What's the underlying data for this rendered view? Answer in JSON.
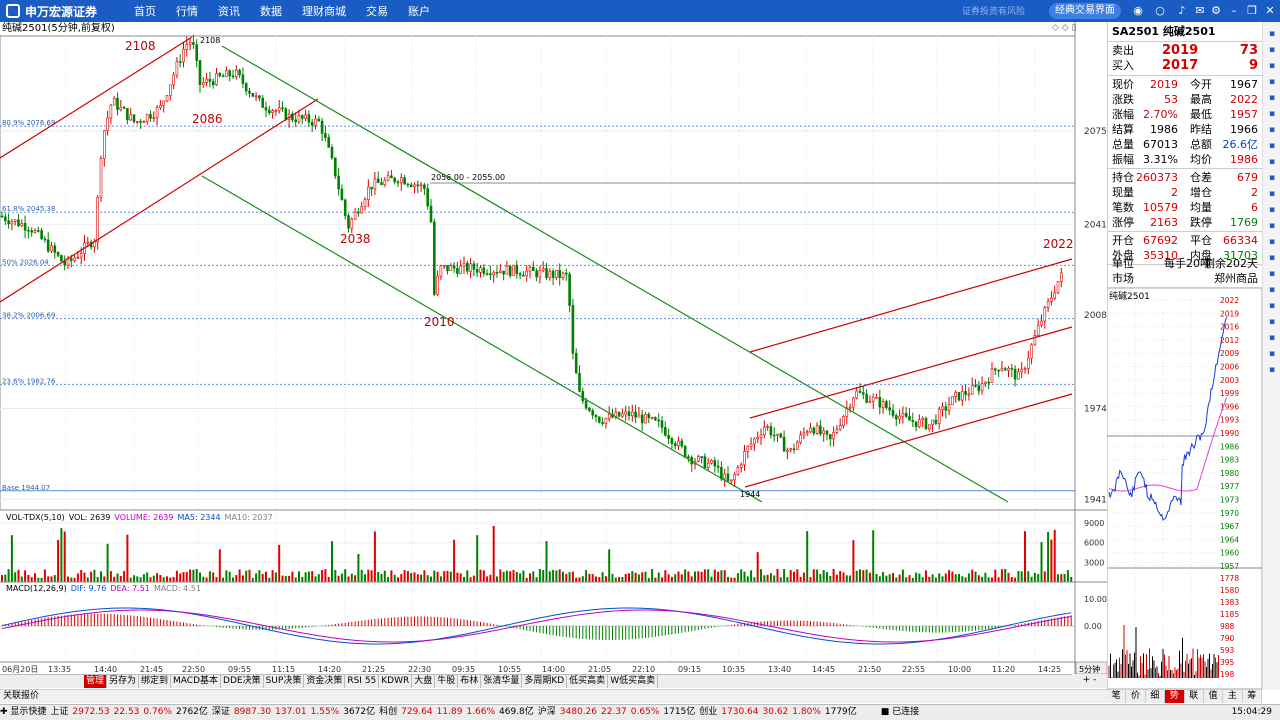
{
  "brand": {
    "name": "申万宏源证券",
    "sub": "SHENWAN HONGYUAN SECURITIES"
  },
  "nav": [
    "首页",
    "行情",
    "资讯",
    "数据",
    "理财商城",
    "交易",
    "账户"
  ],
  "top": {
    "slogan": "证券投资有风险",
    "classic_button": "经典交易界面",
    "icons": [
      "user-icon",
      "circle-icon",
      "bell-icon",
      "mail-icon",
      "gear-icon",
      "minimize-icon",
      "restore-icon",
      "close-icon"
    ]
  },
  "chart": {
    "title": "纯碱2501(5分钟,前复权)",
    "fib_levels": [
      {
        "label": "80.9% 2076.69",
        "value": 2076.69
      },
      {
        "label": "61.8% 2045.38",
        "value": 2045.38
      },
      {
        "label": "50% 2026.04",
        "value": 2026.04
      },
      {
        "label": "38.2% 2006.69",
        "value": 2006.69
      },
      {
        "label": "23.6% 1982.76",
        "value": 1982.76
      },
      {
        "label": "Base 1944.07",
        "value": 1944.07
      }
    ],
    "price_ticks": [
      "2075",
      "2041",
      "2008",
      "1974",
      "1941"
    ],
    "annotations": [
      {
        "text": "2108",
        "color": "red"
      },
      {
        "text": "2086",
        "color": "red"
      },
      {
        "text": "2038",
        "color": "red"
      },
      {
        "text": "2010",
        "color": "red"
      },
      {
        "text": "2022",
        "color": "red"
      }
    ],
    "marks": [
      "2108",
      "1944",
      "2056.00 - 2055.00"
    ],
    "volume_header": {
      "name": "VOL-TDX(5,10)",
      "vol": "VOL: 2639",
      "volume": "VOLUME: 2639",
      "ma5": "MA5: 2344",
      "ma10": "MA10: 2037"
    },
    "volume_ticks": [
      "9000",
      "6000",
      "3000"
    ],
    "macd_header": {
      "name": "MACD(12,26,9)",
      "dif": "DIF: 9.76",
      "dea": "DEA: 7.51",
      "macd": "MACD: 4.51"
    },
    "macd_ticks": [
      "10.00",
      "0.00"
    ],
    "time_ticks": [
      "06月20日",
      "13:35",
      "14:40",
      "21:45",
      "22:50",
      "09:55",
      "11:15",
      "14:20",
      "21:25",
      "22:30",
      "09:35",
      "10:55",
      "14:00",
      "21:05",
      "22:10",
      "09:15",
      "10:35",
      "13:40",
      "14:45",
      "21:50",
      "22:55",
      "10:00",
      "11:20",
      "14:25"
    ],
    "period": "5分钟"
  },
  "quote": {
    "title": "SA2501 纯碱2501",
    "sell": {
      "label": "卖出",
      "price": "2019",
      "qty": "73"
    },
    "buy": {
      "label": "买入",
      "price": "2017",
      "qty": "9"
    },
    "rows1": [
      [
        "现价",
        "2019",
        "今开",
        "1967"
      ],
      [
        "涨跌",
        "53",
        "最高",
        "2022"
      ],
      [
        "涨幅",
        "2.70%",
        "最低",
        "1957"
      ],
      [
        "结算",
        "1986",
        "昨结",
        "1966"
      ],
      [
        "总量",
        "67013",
        "总额",
        "26.6亿"
      ],
      [
        "振幅",
        "3.31%",
        "均价",
        "1986"
      ]
    ],
    "rows2": [
      [
        "持仓",
        "260373",
        "仓差",
        "679"
      ],
      [
        "现量",
        "2",
        "增仓",
        "2"
      ],
      [
        "笔数",
        "10579",
        "均量",
        "6"
      ],
      [
        "涨停",
        "2163",
        "跌停",
        "1769"
      ]
    ],
    "rows3": [
      [
        "开仓",
        "67692",
        "平仓",
        "66334"
      ],
      [
        "外盘",
        "35310",
        "内盘",
        "31703"
      ]
    ],
    "unit": {
      "label": "单位",
      "value": "每手20吨",
      "remain": "剩余202天"
    },
    "market": {
      "label": "市场",
      "value": "郑州商品"
    }
  },
  "mini": {
    "title": "纯碱2501",
    "price_ticks": [
      "2022",
      "2019",
      "2016",
      "2012",
      "2009",
      "2006",
      "2003",
      "1999",
      "1996",
      "1993",
      "1990",
      "1986",
      "1983",
      "1980",
      "1977",
      "1973",
      "1970",
      "1967",
      "1964",
      "1960",
      "1957"
    ],
    "vol_ticks": [
      "1778",
      "1580",
      "1383",
      "1185",
      "988",
      "790",
      "593",
      "395",
      "198"
    ]
  },
  "tabs": [
    "管理",
    "另存为",
    "绑定到",
    "MACD基本",
    "DDE决策",
    "SUP决策",
    "资金决策",
    "RSI 55",
    "KDWR",
    "大盘",
    "牛股",
    "布林",
    "张清华量",
    "多周期KD",
    "低买高卖",
    "W低买高卖"
  ],
  "tab_nav": "+ -",
  "linkage": "关联报价",
  "mini_tabs": [
    "笔",
    "价",
    "细",
    "势",
    "联",
    "值",
    "主",
    "筹"
  ],
  "status": {
    "quick": "显示快捷",
    "items": [
      [
        "上证",
        "2972.53",
        "22.53",
        "0.76%",
        "2762亿"
      ],
      [
        "深证",
        "8987.30",
        "137.01",
        "1.55%",
        "3672亿"
      ],
      [
        "科创",
        "729.64",
        "11.89",
        "1.66%",
        "469.8亿"
      ],
      [
        "沪深",
        "3480.26",
        "22.37",
        "0.65%",
        "1715亿"
      ],
      [
        "创业",
        "1730.64",
        "30.62",
        "1.80%",
        "1779亿"
      ]
    ],
    "conn": "已连接",
    "time": "15:04:29"
  }
}
